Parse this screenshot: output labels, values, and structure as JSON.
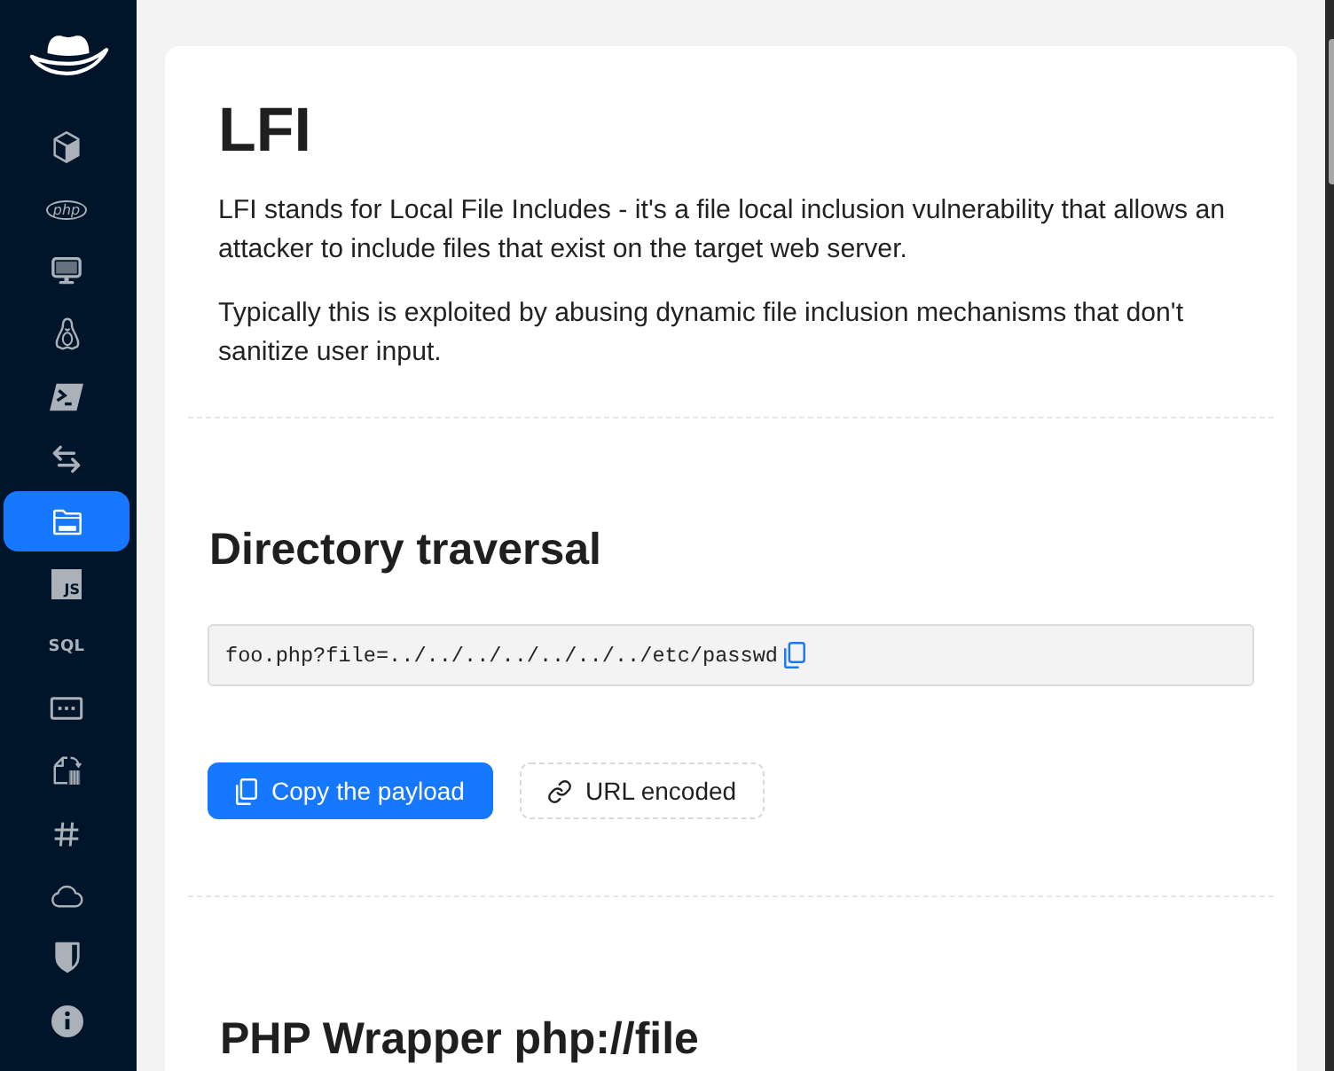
{
  "sidebar": {
    "items": [
      {
        "kind": "icon",
        "selected": false
      },
      {
        "kind": "oval",
        "label": "php",
        "selected": false
      },
      {
        "kind": "icon",
        "selected": false
      },
      {
        "kind": "icon",
        "selected": false
      },
      {
        "kind": "icon",
        "selected": false
      },
      {
        "kind": "icon",
        "selected": false
      },
      {
        "kind": "icon",
        "selected": true
      },
      {
        "kind": "tile",
        "label": "JS",
        "selected": false
      },
      {
        "kind": "text",
        "label": "SQL",
        "selected": false
      },
      {
        "kind": "icon",
        "selected": false
      },
      {
        "kind": "icon",
        "selected": false
      },
      {
        "kind": "icon",
        "selected": false
      },
      {
        "kind": "icon",
        "selected": false
      },
      {
        "kind": "icon",
        "selected": false
      },
      {
        "kind": "icon",
        "selected": false
      }
    ]
  },
  "intro": {
    "title": "LFI",
    "paragraphs": [
      "LFI stands for Local File Includes - it's a file local inclusion vulnerability that allows an attacker to include files that exist on the target web server.",
      "Typically this is exploited by abusing dynamic file inclusion mechanisms that don't sanitize user input."
    ]
  },
  "sections": [
    {
      "heading": "Directory traversal",
      "code": "foo.php?file=../../../../../../../etc/passwd",
      "buttons": [
        {
          "label": "Copy the payload",
          "kind": "primary"
        },
        {
          "label": "URL encoded",
          "kind": "dashed"
        }
      ]
    },
    {
      "heading": "PHP Wrapper php://file"
    }
  ]
}
